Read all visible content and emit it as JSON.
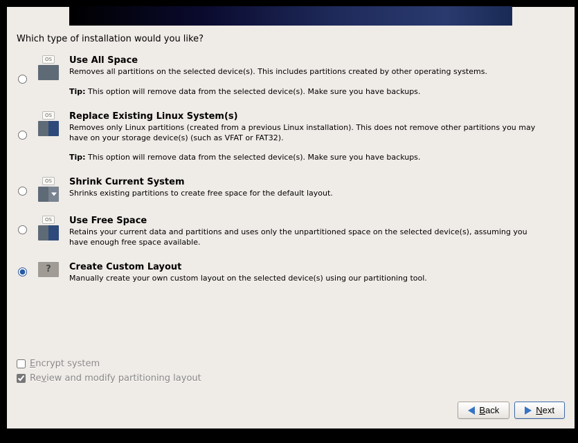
{
  "prompt": "Which type of installation would you like?",
  "options": {
    "use_all": {
      "title": "Use All Space",
      "desc": "Removes all partitions on the selected device(s).  This includes partitions created by other operating systems.",
      "tip_label": "Tip:",
      "tip": " This option will remove data from the selected device(s).  Make sure you have backups.",
      "os_badge": "OS"
    },
    "replace": {
      "title": "Replace Existing Linux System(s)",
      "desc": "Removes only Linux partitions (created from a previous Linux installation).  This does not remove other partitions you may have on your storage device(s) (such as VFAT or FAT32).",
      "tip_label": "Tip:",
      "tip": " This option will remove data from the selected device(s).  Make sure you have backups.",
      "os_badge": "OS"
    },
    "shrink": {
      "title": "Shrink Current System",
      "desc": "Shrinks existing partitions to create free space for the default layout.",
      "os_badge": "OS"
    },
    "free": {
      "title": "Use Free Space",
      "desc": "Retains your current data and partitions and uses only the unpartitioned space on the selected device(s), assuming you have enough free space available.",
      "os_badge": "OS"
    },
    "custom": {
      "title": "Create Custom Layout",
      "desc": "Manually create your own custom layout on the selected device(s) using our partitioning tool.",
      "icon_text": "?"
    }
  },
  "checkboxes": {
    "encrypt": {
      "accel": "E",
      "rest": "ncrypt system",
      "checked": false
    },
    "review": {
      "pre": "Re",
      "accel": "v",
      "rest": "iew and modify partitioning layout",
      "checked": true
    }
  },
  "buttons": {
    "back": {
      "accel": "B",
      "rest": "ack"
    },
    "next": {
      "accel": "N",
      "rest": "ext"
    }
  },
  "selected_option": "custom"
}
